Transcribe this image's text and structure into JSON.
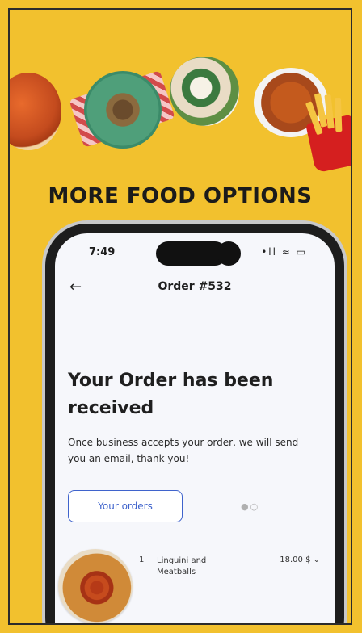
{
  "headline": "MORE FOOD OPTIONS",
  "phone": {
    "status": {
      "time": "7:49",
      "icons": "•ll ≈ ▭"
    },
    "nav": {
      "back_icon": "←",
      "title": "Order #532"
    },
    "heading": "Your Order has been received",
    "description": "Once business accepts your order, we will send you an email, thank you!",
    "orders_button": "Your orders",
    "dots": "●○",
    "item": {
      "quantity": "1",
      "name": "Linguini and Meatballs",
      "price": "18.00 $ ⌄"
    }
  },
  "colors": {
    "background": "#f2c12e",
    "accent": "#3f63cc"
  }
}
